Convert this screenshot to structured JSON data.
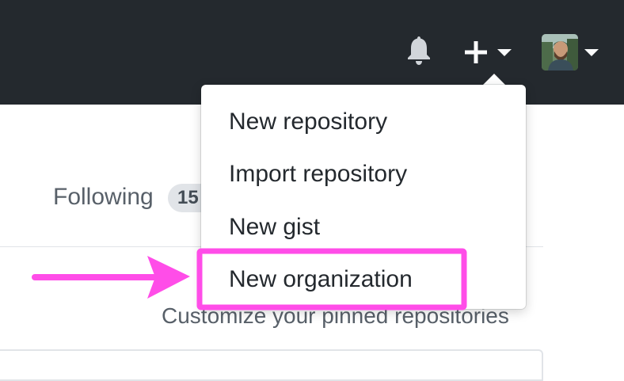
{
  "header": {
    "notifications_icon": "bell-icon",
    "create_icon": "plus-icon",
    "create_caret_icon": "caret-down-icon",
    "avatar_caret_icon": "caret-down-icon"
  },
  "profile": {
    "following_label": "Following",
    "following_count": "15"
  },
  "create_menu": {
    "items": [
      {
        "label": "New repository"
      },
      {
        "label": "Import repository"
      },
      {
        "label": "New gist"
      },
      {
        "label": "New organization"
      }
    ],
    "highlighted_item": "New organization"
  },
  "pinned": {
    "customize_link": "Customize your pinned repositories"
  },
  "annotation": {
    "color": "#ff4de8",
    "arrow_icon": "arrow-right-icon"
  },
  "colors": {
    "header_bg": "#24292e",
    "text_muted": "#586069",
    "text_primary": "#24292e",
    "badge_bg": "#e1e4e8"
  }
}
